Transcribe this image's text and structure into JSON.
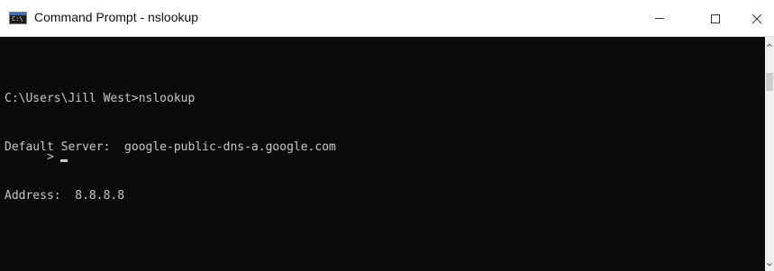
{
  "window": {
    "title": "Command Prompt - nslookup",
    "app_icon_glyph": "C:\\",
    "minimize_label": "Minimize",
    "maximize_label": "Maximize",
    "close_label": "Close"
  },
  "console": {
    "lines": [
      "C:\\Users\\Jill West>nslookup",
      "Default Server:  google-public-dns-a.google.com",
      "Address:  8.8.8.8"
    ],
    "prompt": ">"
  },
  "colors": {
    "console_bg": "#0b0b0b",
    "console_text": "#c8c8c8",
    "titlebar_bg": "#ffffff"
  }
}
